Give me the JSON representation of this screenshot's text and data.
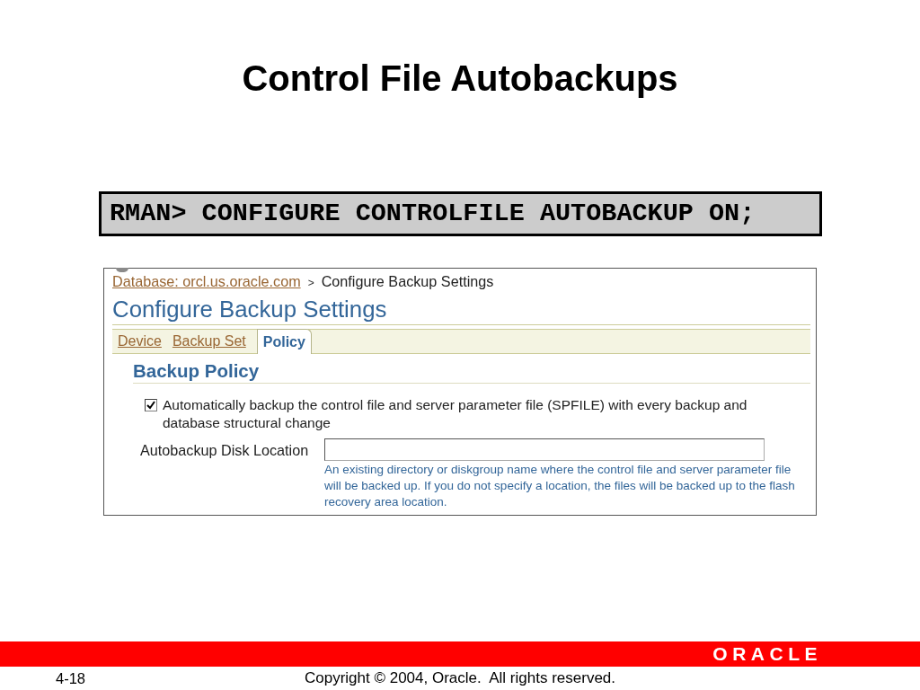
{
  "slide": {
    "title": "Control File Autobackups"
  },
  "command": {
    "text": "RMAN> CONFIGURE CONTROLFILE AUTOBACKUP ON;"
  },
  "screenshot": {
    "breadcrumb": [
      {
        "kind": "link",
        "label": "Database: orcl.us.oracle.com"
      },
      {
        "kind": "separator",
        "label": ">"
      },
      {
        "kind": "current",
        "label": "Configure Backup Settings"
      }
    ],
    "heading": "Configure Backup Settings",
    "tabs": [
      {
        "label": "Device",
        "selected": false
      },
      {
        "label": "Backup Set",
        "selected": false
      },
      {
        "label": "Policy",
        "selected": true
      }
    ],
    "section": {
      "title": "Backup Policy",
      "options": [
        {
          "kind": "checkbox",
          "label": "Automatically backup the control file and server parameter file (SPFILE) with every backup and database structural change",
          "checked": true
        },
        {
          "kind": "text_field",
          "label": "Autobackup Disk Location",
          "help": "An existing directory or diskgroup name where the control file and server parameter file will be backed up. If you do not specify a location, the files will be backed up to the flash recovery area location."
        }
      ]
    }
  },
  "footer": {
    "logo": "ORACLE",
    "page": "4-18",
    "copyright": "Copyright © 2004, Oracle.  All rights reserved."
  }
}
